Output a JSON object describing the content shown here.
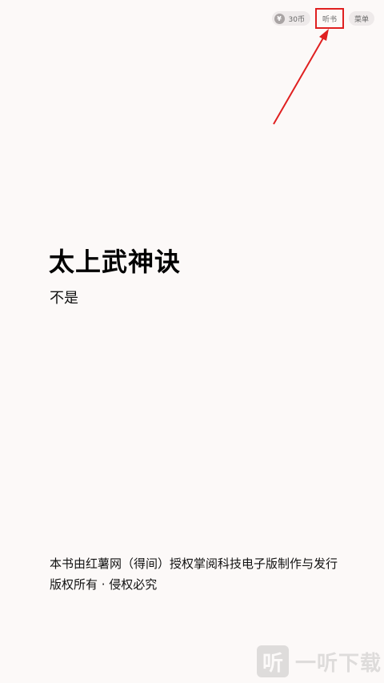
{
  "toolbar": {
    "coin_icon_glyph": "¥",
    "coin_label": "30币",
    "listen_label": "听书",
    "menu_label": "菜单"
  },
  "book": {
    "title": "太上武神诀",
    "author": "不是"
  },
  "copyright": {
    "line1": "本书由红薯网（得间）授权掌阅科技电子版制作与发行",
    "line2": "版权所有 · 侵权必究"
  },
  "watermark": {
    "icon_glyph": "听",
    "text": "一听下载"
  },
  "colors": {
    "background": "#fcf9f8",
    "highlight": "#e02020"
  }
}
